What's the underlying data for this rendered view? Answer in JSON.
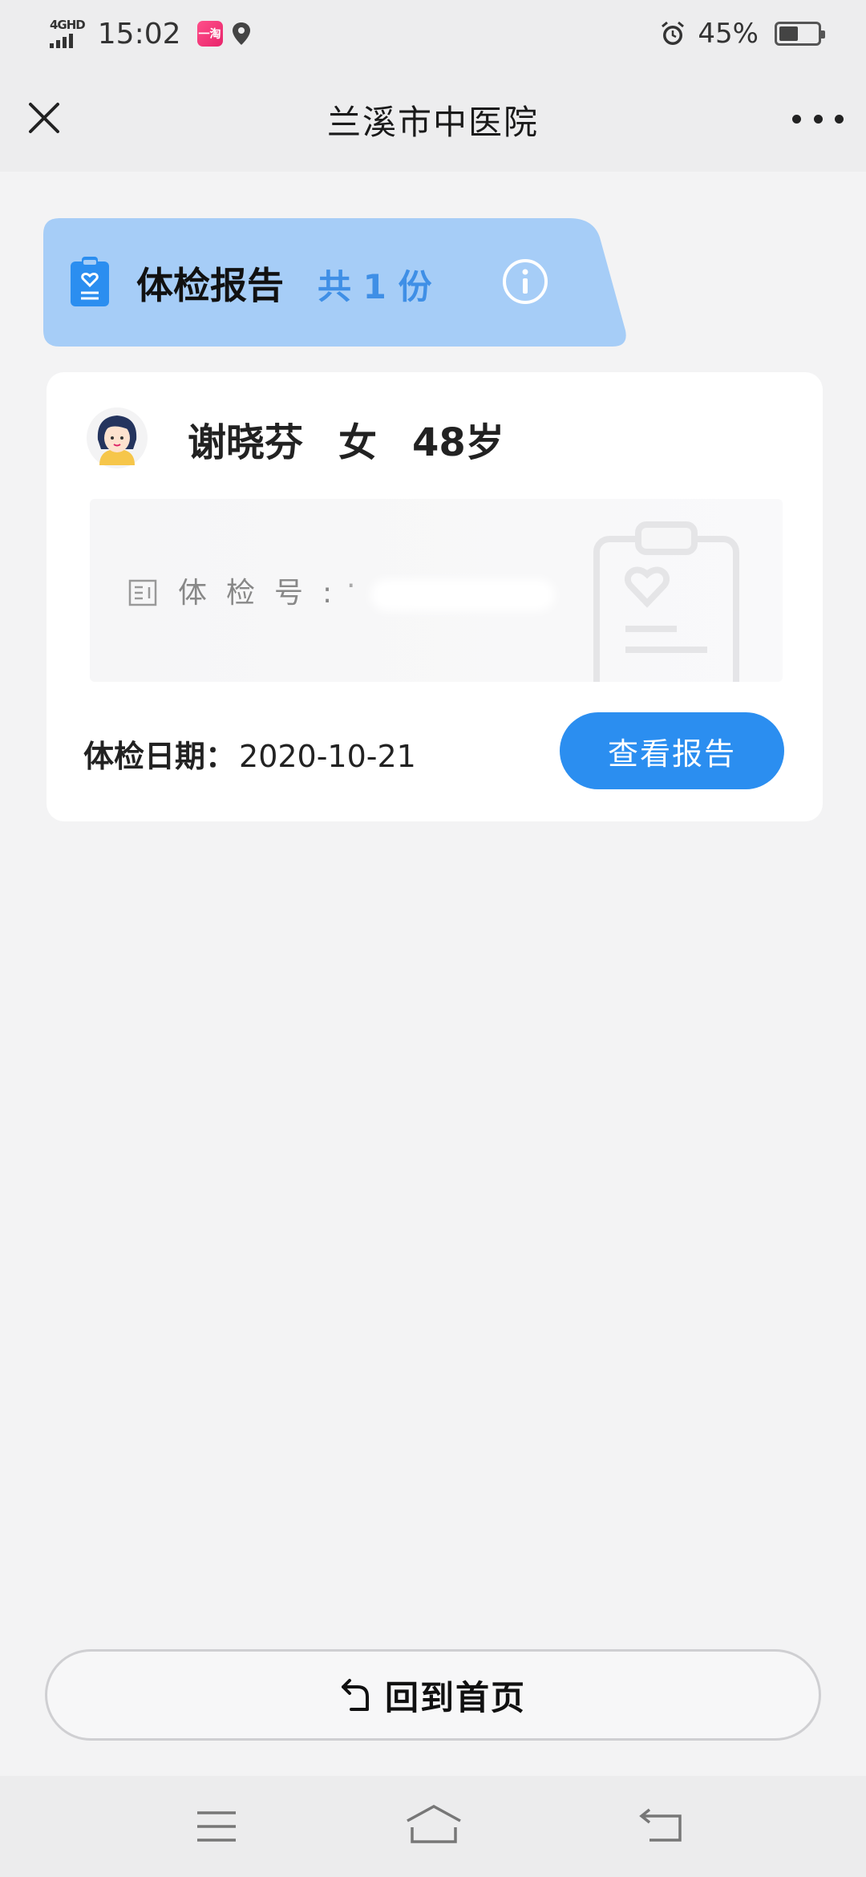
{
  "status_bar": {
    "network": "4GHD",
    "time": "15:02",
    "app_badge": "一淘",
    "battery_percent": "45%",
    "battery_level": 0.45
  },
  "nav": {
    "title": "兰溪市中医院"
  },
  "header": {
    "title": "体检报告",
    "count": "共 1 份"
  },
  "record": {
    "name": "谢晓芬",
    "gender": "女",
    "age": "48岁",
    "id_label": "体检号:",
    "id_value": "·",
    "date_label": "体检日期：",
    "date_value": "2020-10-21",
    "view_button": "查看报告"
  },
  "footer": {
    "home_button": "回到首页"
  },
  "colors": {
    "accent": "#2b8ef0",
    "banner": "#a6cdf7",
    "count_text": "#3f8fe6"
  },
  "icons": [
    "close-icon",
    "more-icon",
    "clipboard-icon",
    "info-icon",
    "avatar",
    "id-card-icon",
    "return-arrow-icon",
    "menu-icon",
    "home-icon",
    "back-icon"
  ]
}
